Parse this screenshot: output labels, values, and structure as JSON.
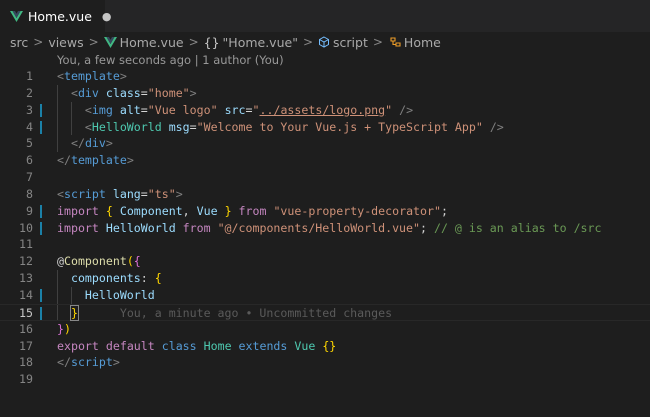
{
  "tab": {
    "label": "Home.vue",
    "modified_indicator": "●",
    "icon": "vue-icon"
  },
  "breadcrumb": {
    "items": [
      {
        "label": "src"
      },
      {
        "label": "views"
      },
      {
        "label": "Home.vue",
        "icon": "vue-icon"
      },
      {
        "label": "\"Home.vue\"",
        "icon": "braces-icon",
        "icon_text": "{}"
      },
      {
        "label": "script",
        "icon": "cube-icon"
      },
      {
        "label": "Home",
        "icon": "class-icon"
      }
    ],
    "separator": ">"
  },
  "codelens": "You, a few seconds ago | 1 author (You)",
  "editor": {
    "active_line": 15,
    "lines": [
      {
        "n": "1",
        "tokens": [
          [
            "t-tag",
            "<"
          ],
          [
            "t-el",
            "template"
          ],
          [
            "t-tag",
            ">"
          ]
        ]
      },
      {
        "n": "2",
        "tokens": [
          [
            "t-txt",
            "  "
          ],
          [
            "t-tag",
            "<"
          ],
          [
            "t-el",
            "div"
          ],
          [
            "t-txt",
            " "
          ],
          [
            "t-at",
            "class"
          ],
          [
            "t-txt",
            "="
          ],
          [
            "t-str",
            "\"home\""
          ],
          [
            "t-tag",
            ">"
          ]
        ]
      },
      {
        "n": "3",
        "tokens": [
          [
            "t-txt",
            "    "
          ],
          [
            "t-tag",
            "<"
          ],
          [
            "t-el",
            "img"
          ],
          [
            "t-txt",
            " "
          ],
          [
            "t-at",
            "alt"
          ],
          [
            "t-txt",
            "="
          ],
          [
            "t-str",
            "\"Vue logo\""
          ],
          [
            "t-txt",
            " "
          ],
          [
            "t-at",
            "src"
          ],
          [
            "t-txt",
            "="
          ],
          [
            "t-str",
            "\""
          ],
          [
            "t-link",
            "../assets/logo.png"
          ],
          [
            "t-str",
            "\""
          ],
          [
            "t-txt",
            " "
          ],
          [
            "t-tag",
            "/>"
          ]
        ]
      },
      {
        "n": "4",
        "tokens": [
          [
            "t-txt",
            "    "
          ],
          [
            "t-tag",
            "<"
          ],
          [
            "t-cls",
            "HelloWorld"
          ],
          [
            "t-txt",
            " "
          ],
          [
            "t-at",
            "msg"
          ],
          [
            "t-txt",
            "="
          ],
          [
            "t-str",
            "\"Welcome to Your Vue.js + TypeScript App\""
          ],
          [
            "t-txt",
            " "
          ],
          [
            "t-tag",
            "/>"
          ]
        ]
      },
      {
        "n": "5",
        "tokens": [
          [
            "t-txt",
            "  "
          ],
          [
            "t-tag",
            "</"
          ],
          [
            "t-el",
            "div"
          ],
          [
            "t-tag",
            ">"
          ]
        ]
      },
      {
        "n": "6",
        "tokens": [
          [
            "t-tag",
            "</"
          ],
          [
            "t-el",
            "template"
          ],
          [
            "t-tag",
            ">"
          ]
        ]
      },
      {
        "n": "7",
        "tokens": []
      },
      {
        "n": "8",
        "tokens": [
          [
            "t-tag",
            "<"
          ],
          [
            "t-el",
            "script"
          ],
          [
            "t-txt",
            " "
          ],
          [
            "t-at",
            "lang"
          ],
          [
            "t-txt",
            "="
          ],
          [
            "t-str",
            "\"ts\""
          ],
          [
            "t-tag",
            ">"
          ]
        ]
      },
      {
        "n": "9",
        "tokens": [
          [
            "t-kw",
            "import"
          ],
          [
            "t-txt",
            " "
          ],
          [
            "t-br",
            "{"
          ],
          [
            "t-txt",
            " "
          ],
          [
            "t-var",
            "Component"
          ],
          [
            "t-txt",
            ", "
          ],
          [
            "t-var",
            "Vue"
          ],
          [
            "t-txt",
            " "
          ],
          [
            "t-br",
            "}"
          ],
          [
            "t-txt",
            " "
          ],
          [
            "t-kw",
            "from"
          ],
          [
            "t-txt",
            " "
          ],
          [
            "t-str",
            "\"vue-property-decorator\""
          ],
          [
            "t-txt",
            ";"
          ]
        ]
      },
      {
        "n": "10",
        "tokens": [
          [
            "t-kw",
            "import"
          ],
          [
            "t-txt",
            " "
          ],
          [
            "t-var",
            "HelloWorld"
          ],
          [
            "t-txt",
            " "
          ],
          [
            "t-kw",
            "from"
          ],
          [
            "t-txt",
            " "
          ],
          [
            "t-str",
            "\"@/components/HelloWorld.vue\""
          ],
          [
            "t-txt",
            "; "
          ],
          [
            "t-com",
            "// @ is an alias to /src"
          ]
        ]
      },
      {
        "n": "11",
        "tokens": []
      },
      {
        "n": "12",
        "tokens": [
          [
            "t-txt",
            "@"
          ],
          [
            "t-fn",
            "Component"
          ],
          [
            "t-br",
            "("
          ],
          [
            "t-br2",
            "{"
          ]
        ]
      },
      {
        "n": "13",
        "tokens": [
          [
            "t-txt",
            "  "
          ],
          [
            "t-var",
            "components"
          ],
          [
            "t-txt",
            ": "
          ],
          [
            "t-br",
            "{"
          ]
        ]
      },
      {
        "n": "14",
        "tokens": [
          [
            "t-txt",
            "    "
          ],
          [
            "t-var",
            "HelloWorld"
          ]
        ]
      },
      {
        "n": "15",
        "tokens": [
          [
            "t-txt",
            "  "
          ],
          [
            "t-br",
            "}"
          ]
        ],
        "blame": "      You, a minute ago • Uncommitted changes"
      },
      {
        "n": "16",
        "tokens": [
          [
            "t-br2",
            "}"
          ],
          [
            "t-br",
            ")"
          ]
        ]
      },
      {
        "n": "17",
        "tokens": [
          [
            "t-kw",
            "export"
          ],
          [
            "t-txt",
            " "
          ],
          [
            "t-kw",
            "default"
          ],
          [
            "t-txt",
            " "
          ],
          [
            "t-kw2",
            "class"
          ],
          [
            "t-txt",
            " "
          ],
          [
            "t-cls",
            "Home"
          ],
          [
            "t-txt",
            " "
          ],
          [
            "t-kw2",
            "extends"
          ],
          [
            "t-txt",
            " "
          ],
          [
            "t-cls",
            "Vue"
          ],
          [
            "t-txt",
            " "
          ],
          [
            "t-br",
            "{}"
          ]
        ]
      },
      {
        "n": "18",
        "tokens": [
          [
            "t-tag",
            "</"
          ],
          [
            "t-el",
            "script"
          ],
          [
            "t-tag",
            ">"
          ]
        ]
      },
      {
        "n": "19",
        "tokens": []
      }
    ],
    "modified_lines": [
      3,
      4,
      9,
      10,
      14,
      15
    ]
  }
}
